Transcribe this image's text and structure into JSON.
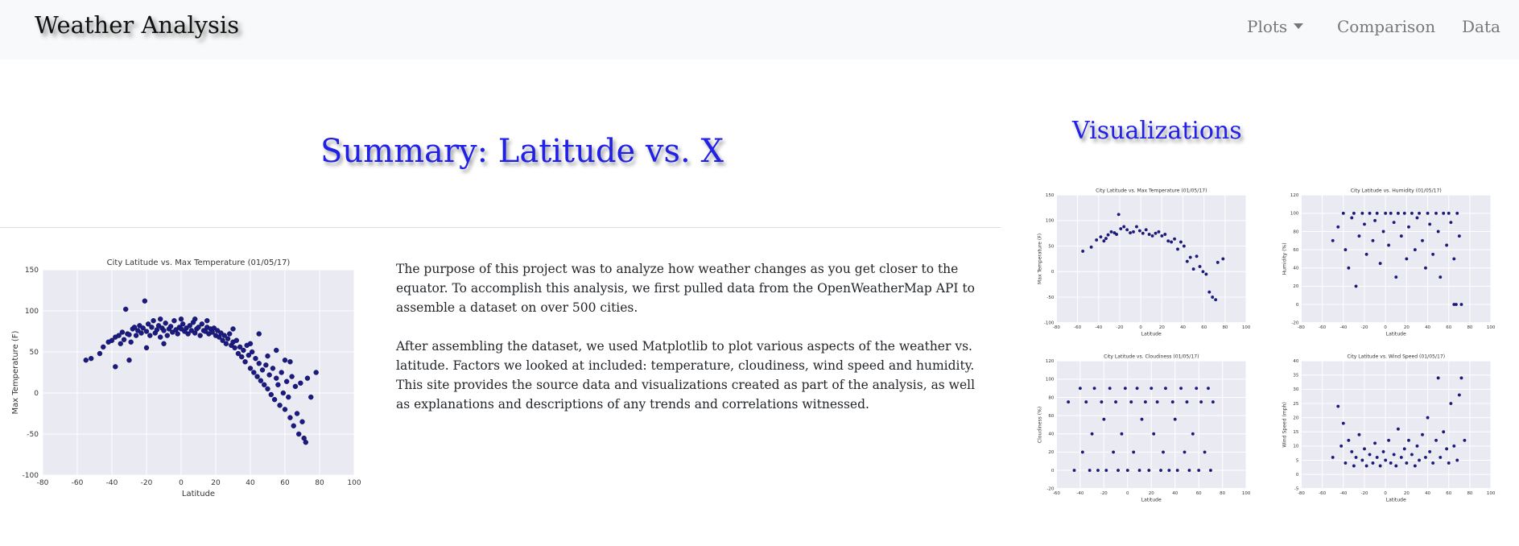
{
  "navbar": {
    "brand": "Weather Analysis",
    "items": [
      {
        "label": "Plots",
        "dropdown": true
      },
      {
        "label": "Comparison"
      },
      {
        "label": "Data"
      }
    ]
  },
  "summary": {
    "title": "Summary: Latitude vs. X",
    "paragraphs": [
      "The purpose of this project was to analyze how weather changes as you get closer to the equator. To accomplish this analysis, we first pulled data from the OpenWeatherMap API to assemble a dataset on over 500 cities.",
      "After assembling the dataset, we used Matplotlib to plot various aspects of the weather vs. latitude. Factors we looked at included: temperature, cloudiness, wind speed and humidity. This site provides the source data and visualizations created as part of the analysis, as well as explanations and descriptions of any trends and correlations witnessed."
    ]
  },
  "visualizations": {
    "title": "Visualizations"
  },
  "colors": {
    "heading": "#2020e6",
    "point": "#1a1a80",
    "plot_background": "#eaeaf2",
    "grid": "#ffffff"
  },
  "chart_data": [
    {
      "type": "scatter",
      "title": "City Latitude vs. Max Temperature (01/05/17)",
      "xlabel": "Latitude",
      "ylabel": "Max Temperature (F)",
      "xlim": [
        -80,
        100
      ],
      "ylim": [
        -100,
        150
      ],
      "xticks": [
        -80,
        -60,
        -40,
        -20,
        0,
        20,
        40,
        60,
        80,
        100
      ],
      "yticks": [
        -100,
        -50,
        0,
        50,
        100,
        150
      ],
      "grid": true,
      "points": [
        [
          -55,
          40
        ],
        [
          -52,
          42
        ],
        [
          -47,
          48
        ],
        [
          -45,
          56
        ],
        [
          -42,
          62
        ],
        [
          -40,
          64
        ],
        [
          -38,
          68
        ],
        [
          -36,
          70
        ],
        [
          -35,
          60
        ],
        [
          -34,
          74
        ],
        [
          -33,
          65
        ],
        [
          -32,
          102
        ],
        [
          -31,
          72
        ],
        [
          -30,
          71
        ],
        [
          -29,
          62
        ],
        [
          -28,
          78
        ],
        [
          -27,
          80
        ],
        [
          -26,
          70
        ],
        [
          -25,
          76
        ],
        [
          -24,
          82
        ],
        [
          -23,
          73
        ],
        [
          -22,
          79
        ],
        [
          -21,
          112
        ],
        [
          -20,
          75
        ],
        [
          -19,
          84
        ],
        [
          -18,
          70
        ],
        [
          -17,
          80
        ],
        [
          -16,
          88
        ],
        [
          -15,
          73
        ],
        [
          -14,
          77
        ],
        [
          -13,
          82
        ],
        [
          -12,
          68
        ],
        [
          -11,
          79
        ],
        [
          -10,
          76
        ],
        [
          -9,
          85
        ],
        [
          -8,
          70
        ],
        [
          -7,
          78
        ],
        [
          -6,
          81
        ],
        [
          -5,
          74
        ],
        [
          -4,
          88
        ],
        [
          -3,
          77
        ],
        [
          -2,
          72
        ],
        [
          -1,
          80
        ],
        [
          0,
          78
        ],
        [
          1,
          84
        ],
        [
          2,
          75
        ],
        [
          3,
          79
        ],
        [
          4,
          72
        ],
        [
          5,
          82
        ],
        [
          6,
          76
        ],
        [
          7,
          86
        ],
        [
          8,
          73
        ],
        [
          9,
          78
        ],
        [
          10,
          80
        ],
        [
          11,
          70
        ],
        [
          12,
          84
        ],
        [
          13,
          76
        ],
        [
          14,
          75
        ],
        [
          15,
          80
        ],
        [
          16,
          72
        ],
        [
          17,
          78
        ],
        [
          18,
          74
        ],
        [
          19,
          79
        ],
        [
          20,
          70
        ],
        [
          21,
          76
        ],
        [
          22,
          68
        ],
        [
          23,
          73
        ],
        [
          24,
          64
        ],
        [
          25,
          70
        ],
        [
          26,
          60
        ],
        [
          27,
          66
        ],
        [
          28,
          72
        ],
        [
          29,
          58
        ],
        [
          30,
          62
        ],
        [
          31,
          55
        ],
        [
          32,
          64
        ],
        [
          33,
          48
        ],
        [
          34,
          56
        ],
        [
          35,
          44
        ],
        [
          36,
          52
        ],
        [
          37,
          38
        ],
        [
          38,
          58
        ],
        [
          39,
          46
        ],
        [
          40,
          30
        ],
        [
          41,
          50
        ],
        [
          42,
          25
        ],
        [
          43,
          42
        ],
        [
          44,
          20
        ],
        [
          45,
          36
        ],
        [
          46,
          15
        ],
        [
          47,
          28
        ],
        [
          48,
          10
        ],
        [
          49,
          34
        ],
        [
          50,
          5
        ],
        [
          51,
          22
        ],
        [
          52,
          -2
        ],
        [
          53,
          30
        ],
        [
          54,
          -8
        ],
        [
          55,
          18
        ],
        [
          56,
          10
        ],
        [
          57,
          -15
        ],
        [
          58,
          25
        ],
        [
          59,
          0
        ],
        [
          60,
          -20
        ],
        [
          61,
          14
        ],
        [
          62,
          -5
        ],
        [
          63,
          -30
        ],
        [
          64,
          20
        ],
        [
          65,
          -40
        ],
        [
          66,
          8
        ],
        [
          67,
          -25
        ],
        [
          68,
          -50
        ],
        [
          69,
          12
        ],
        [
          70,
          -35
        ],
        [
          71,
          -55
        ],
        [
          72,
          -60
        ],
        [
          73,
          18
        ],
        [
          75,
          -5
        ],
        [
          78,
          25
        ],
        [
          -38,
          32
        ],
        [
          -30,
          40
        ],
        [
          -20,
          55
        ],
        [
          -10,
          60
        ],
        [
          30,
          78
        ],
        [
          40,
          60
        ],
        [
          45,
          72
        ],
        [
          50,
          45
        ],
        [
          55,
          52
        ],
        [
          60,
          40
        ],
        [
          63,
          38
        ],
        [
          -12,
          90
        ],
        [
          0,
          90
        ],
        [
          8,
          90
        ],
        [
          15,
          88
        ]
      ]
    },
    {
      "type": "scatter",
      "title": "City Latitude vs. Max Temperature (01/05/17)",
      "xlabel": "Latitude",
      "ylabel": "Max Temperature (F)",
      "xlim": [
        -80,
        100
      ],
      "ylim": [
        -100,
        150
      ],
      "xticks": [
        -80,
        -60,
        -40,
        -20,
        0,
        20,
        40,
        60,
        80,
        100
      ],
      "yticks": [
        -100,
        -50,
        0,
        50,
        100,
        150
      ],
      "grid": true,
      "points": [
        [
          -55,
          40
        ],
        [
          -47,
          48
        ],
        [
          -42,
          62
        ],
        [
          -38,
          68
        ],
        [
          -35,
          60
        ],
        [
          -33,
          65
        ],
        [
          -31,
          72
        ],
        [
          -28,
          78
        ],
        [
          -25,
          76
        ],
        [
          -23,
          73
        ],
        [
          -21,
          112
        ],
        [
          -19,
          84
        ],
        [
          -16,
          88
        ],
        [
          -13,
          82
        ],
        [
          -10,
          76
        ],
        [
          -7,
          78
        ],
        [
          -4,
          88
        ],
        [
          -1,
          80
        ],
        [
          2,
          75
        ],
        [
          5,
          82
        ],
        [
          8,
          73
        ],
        [
          11,
          70
        ],
        [
          14,
          75
        ],
        [
          17,
          78
        ],
        [
          20,
          70
        ],
        [
          23,
          73
        ],
        [
          26,
          60
        ],
        [
          29,
          58
        ],
        [
          32,
          64
        ],
        [
          35,
          44
        ],
        [
          38,
          58
        ],
        [
          41,
          50
        ],
        [
          44,
          20
        ],
        [
          47,
          28
        ],
        [
          50,
          5
        ],
        [
          53,
          30
        ],
        [
          56,
          10
        ],
        [
          59,
          0
        ],
        [
          62,
          -5
        ],
        [
          65,
          -40
        ],
        [
          68,
          -50
        ],
        [
          71,
          -55
        ],
        [
          73,
          18
        ],
        [
          78,
          25
        ]
      ]
    },
    {
      "type": "scatter",
      "title": "City Latitude vs. Humidity (01/05/17)",
      "xlabel": "Latitude",
      "ylabel": "Humidity (%)",
      "xlim": [
        -80,
        100
      ],
      "ylim": [
        -20,
        120
      ],
      "xticks": [
        -80,
        -60,
        -40,
        -20,
        0,
        20,
        40,
        60,
        80,
        100
      ],
      "yticks": [
        -20,
        0,
        20,
        40,
        60,
        80,
        100,
        120
      ],
      "grid": true,
      "points": [
        [
          -50,
          70
        ],
        [
          -45,
          85
        ],
        [
          -40,
          100
        ],
        [
          -38,
          60
        ],
        [
          -35,
          40
        ],
        [
          -32,
          95
        ],
        [
          -30,
          100
        ],
        [
          -28,
          20
        ],
        [
          -25,
          75
        ],
        [
          -22,
          100
        ],
        [
          -20,
          88
        ],
        [
          -18,
          55
        ],
        [
          -15,
          100
        ],
        [
          -12,
          70
        ],
        [
          -10,
          92
        ],
        [
          -8,
          100
        ],
        [
          -5,
          45
        ],
        [
          -2,
          80
        ],
        [
          0,
          100
        ],
        [
          3,
          65
        ],
        [
          5,
          100
        ],
        [
          8,
          90
        ],
        [
          10,
          30
        ],
        [
          12,
          100
        ],
        [
          15,
          75
        ],
        [
          18,
          100
        ],
        [
          20,
          50
        ],
        [
          22,
          85
        ],
        [
          25,
          100
        ],
        [
          28,
          60
        ],
        [
          30,
          95
        ],
        [
          32,
          100
        ],
        [
          35,
          70
        ],
        [
          38,
          40
        ],
        [
          40,
          100
        ],
        [
          42,
          88
        ],
        [
          45,
          55
        ],
        [
          48,
          100
        ],
        [
          50,
          80
        ],
        [
          52,
          30
        ],
        [
          55,
          100
        ],
        [
          58,
          65
        ],
        [
          60,
          100
        ],
        [
          62,
          90
        ],
        [
          65,
          50
        ],
        [
          68,
          100
        ],
        [
          70,
          75
        ],
        [
          72,
          0
        ],
        [
          65,
          0
        ],
        [
          67,
          0
        ]
      ]
    },
    {
      "type": "scatter",
      "title": "City Latitude vs. Cloudiness (01/05/17)",
      "xlabel": "Latitude",
      "ylabel": "Cloudiness (%)",
      "xlim": [
        -60,
        100
      ],
      "ylim": [
        -20,
        120
      ],
      "xticks": [
        -60,
        -40,
        -20,
        0,
        20,
        40,
        60,
        80,
        100
      ],
      "yticks": [
        -20,
        0,
        20,
        40,
        60,
        80,
        100,
        120
      ],
      "grid": true,
      "points": [
        [
          -50,
          75
        ],
        [
          -45,
          0
        ],
        [
          -40,
          90
        ],
        [
          -38,
          20
        ],
        [
          -35,
          75
        ],
        [
          -32,
          0
        ],
        [
          -30,
          40
        ],
        [
          -28,
          90
        ],
        [
          -25,
          0
        ],
        [
          -22,
          75
        ],
        [
          -20,
          56
        ],
        [
          -18,
          0
        ],
        [
          -15,
          90
        ],
        [
          -12,
          20
        ],
        [
          -10,
          75
        ],
        [
          -8,
          0
        ],
        [
          -5,
          40
        ],
        [
          -2,
          90
        ],
        [
          0,
          0
        ],
        [
          3,
          75
        ],
        [
          5,
          20
        ],
        [
          8,
          90
        ],
        [
          10,
          0
        ],
        [
          12,
          56
        ],
        [
          15,
          75
        ],
        [
          18,
          0
        ],
        [
          20,
          90
        ],
        [
          22,
          40
        ],
        [
          25,
          75
        ],
        [
          28,
          0
        ],
        [
          30,
          20
        ],
        [
          32,
          90
        ],
        [
          35,
          0
        ],
        [
          38,
          75
        ],
        [
          40,
          56
        ],
        [
          42,
          0
        ],
        [
          45,
          90
        ],
        [
          48,
          20
        ],
        [
          50,
          75
        ],
        [
          52,
          0
        ],
        [
          55,
          40
        ],
        [
          58,
          90
        ],
        [
          60,
          0
        ],
        [
          62,
          75
        ],
        [
          65,
          20
        ],
        [
          68,
          90
        ],
        [
          70,
          0
        ],
        [
          72,
          75
        ]
      ]
    },
    {
      "type": "scatter",
      "title": "City Latitude vs. Wind Speed (01/05/17)",
      "xlabel": "Latitude",
      "ylabel": "Wind Speed (mph)",
      "xlim": [
        -80,
        100
      ],
      "ylim": [
        -5,
        40
      ],
      "xticks": [
        -80,
        -60,
        -40,
        -20,
        0,
        20,
        40,
        60,
        80,
        100
      ],
      "yticks": [
        -5,
        0,
        5,
        10,
        15,
        20,
        25,
        30,
        35,
        40
      ],
      "grid": true,
      "points": [
        [
          -50,
          6
        ],
        [
          -45,
          24
        ],
        [
          -42,
          10
        ],
        [
          -40,
          18
        ],
        [
          -38,
          4
        ],
        [
          -35,
          12
        ],
        [
          -32,
          8
        ],
        [
          -30,
          3
        ],
        [
          -28,
          6
        ],
        [
          -25,
          14
        ],
        [
          -22,
          5
        ],
        [
          -20,
          9
        ],
        [
          -18,
          3
        ],
        [
          -15,
          7
        ],
        [
          -12,
          4
        ],
        [
          -10,
          11
        ],
        [
          -8,
          6
        ],
        [
          -5,
          3
        ],
        [
          -2,
          8
        ],
        [
          0,
          5
        ],
        [
          3,
          12
        ],
        [
          5,
          4
        ],
        [
          8,
          7
        ],
        [
          10,
          3
        ],
        [
          12,
          16
        ],
        [
          15,
          6
        ],
        [
          18,
          9
        ],
        [
          20,
          4
        ],
        [
          22,
          12
        ],
        [
          25,
          7
        ],
        [
          28,
          3
        ],
        [
          30,
          10
        ],
        [
          32,
          5
        ],
        [
          35,
          14
        ],
        [
          38,
          6
        ],
        [
          40,
          20
        ],
        [
          42,
          8
        ],
        [
          45,
          4
        ],
        [
          48,
          12
        ],
        [
          50,
          34
        ],
        [
          52,
          6
        ],
        [
          55,
          15
        ],
        [
          58,
          9
        ],
        [
          60,
          4
        ],
        [
          62,
          25
        ],
        [
          65,
          10
        ],
        [
          68,
          5
        ],
        [
          70,
          28
        ],
        [
          72,
          34
        ],
        [
          75,
          12
        ]
      ]
    }
  ]
}
